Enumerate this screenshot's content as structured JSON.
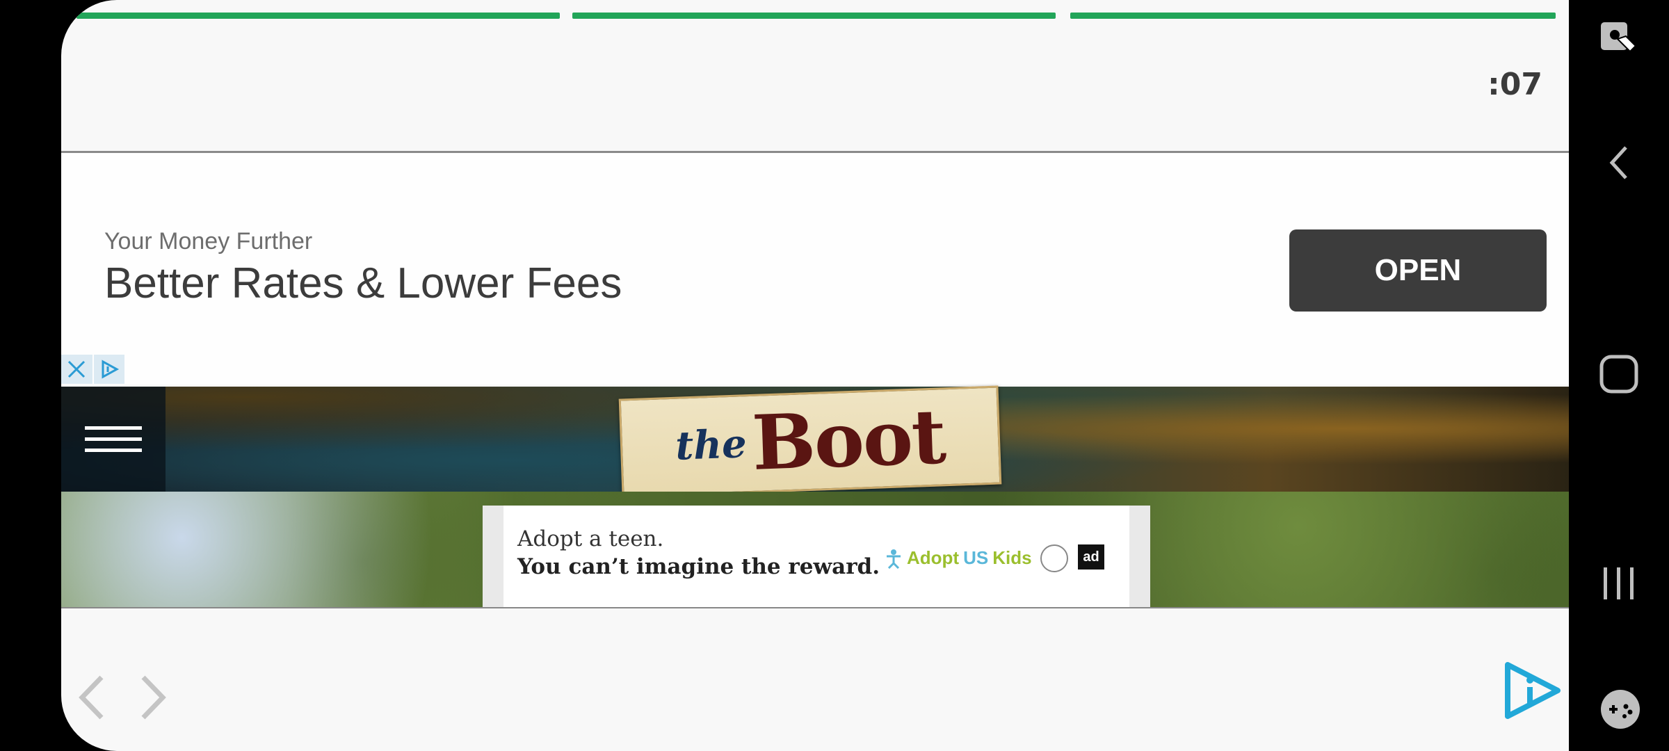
{
  "story_progress": {
    "segments": 3,
    "colors": {
      "active": "#22a559"
    }
  },
  "timer": {
    "label": ":07"
  },
  "ad": {
    "subtitle": "Your Money Further",
    "title": "Better Rates & Lower Fees",
    "open_label": "OPEN",
    "adchoices": {
      "close_icon": "close-icon",
      "info_icon": "adchoices-icon"
    }
  },
  "site": {
    "menu_icon": "hamburger-icon",
    "logo_prefix": "the",
    "logo_name": "Boot"
  },
  "inner_ad": {
    "line1": "Adopt a teen.",
    "line2": "You can’t imagine the reward.",
    "brand_part1": "Adopt",
    "brand_part2": "US",
    "brand_part3": "Kids",
    "badge": "ad"
  },
  "navigation": {
    "prev_icon": "chevron-left-icon",
    "next_icon": "chevron-right-icon"
  },
  "brand_icon": "play-info-icon",
  "system_bar": {
    "icons": [
      "accessibility-touch-icon",
      "back-icon",
      "home-icon",
      "recents-icon",
      "game-tools-icon"
    ]
  }
}
